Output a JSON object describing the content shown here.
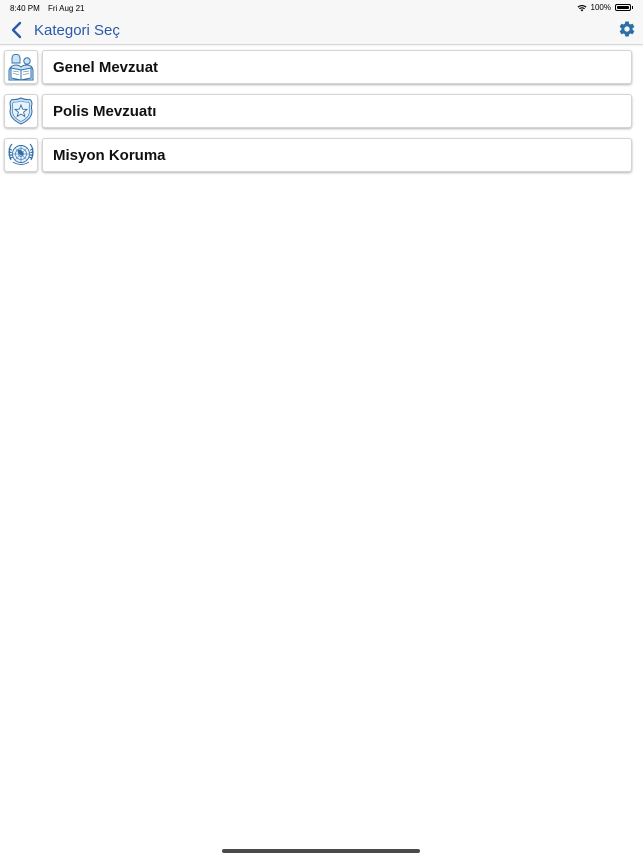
{
  "status_bar": {
    "time": "8:40 PM",
    "date": "Fri Aug 21",
    "battery_percent": "100%",
    "battery_level": 1.0,
    "wifi_icon": "wifi-icon",
    "battery_icon": "battery-icon"
  },
  "nav": {
    "back_icon": "chevron-left-icon",
    "title": "Kategori Seç",
    "settings_icon": "gear-icon"
  },
  "categories": [
    {
      "label": "Genel Mevzuat",
      "icon": "people-reading-book-icon"
    },
    {
      "label": "Polis Mevzuatı",
      "icon": "police-badge-star-icon"
    },
    {
      "label": "Misyon Koruma",
      "icon": "united-nations-emblem-icon"
    }
  ],
  "colors": {
    "accent": "#2a5aa8",
    "icon_blue": "#2f6fa8",
    "icon_fill": "#cfe3f7",
    "nav_background": "#f7f7f7"
  }
}
